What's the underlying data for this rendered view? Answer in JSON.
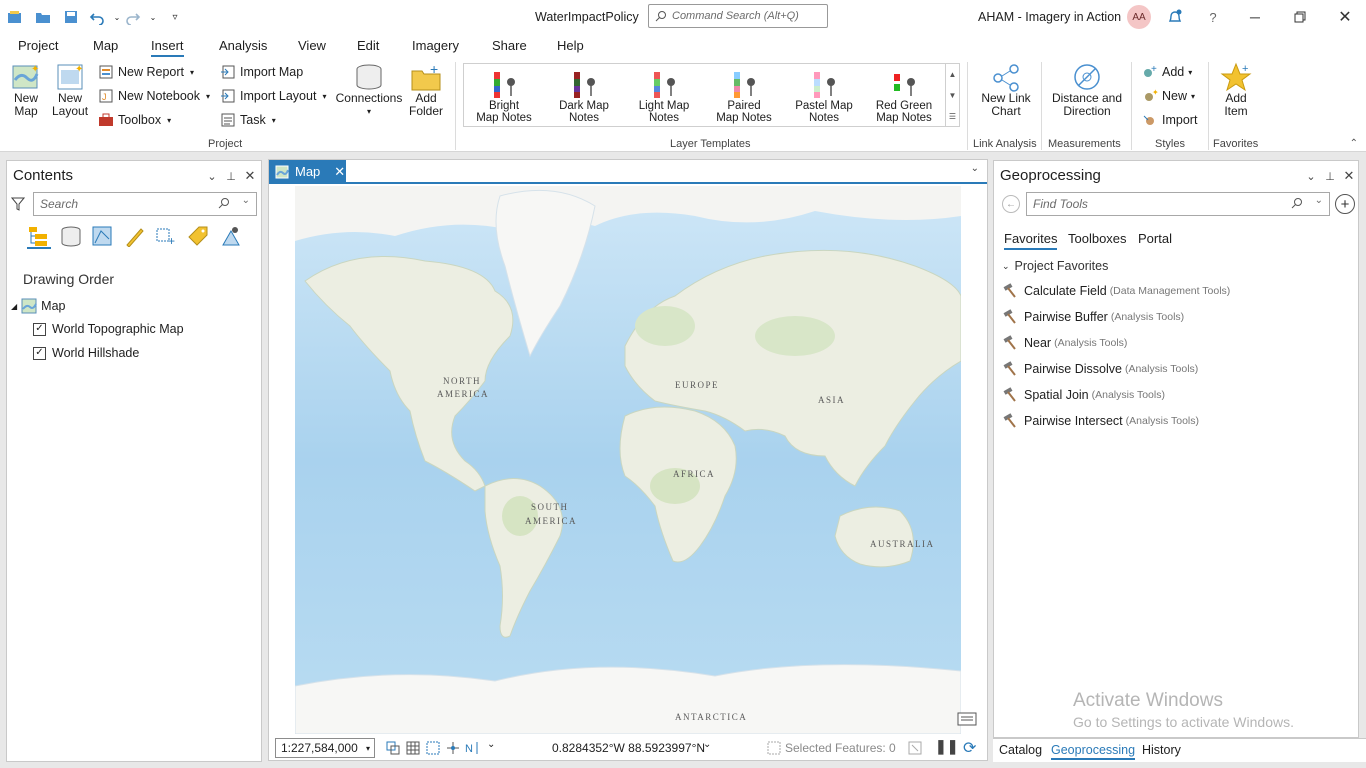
{
  "title_bar": {
    "title": "WaterImpactPolicy",
    "command_search_placeholder": "Command Search (Alt+Q)",
    "project_label": "AHAM - Imagery in Action",
    "user_initials": "AA"
  },
  "menu_tabs": [
    "Project",
    "Map",
    "Insert",
    "Analysis",
    "View",
    "Edit",
    "Imagery",
    "Share",
    "Help"
  ],
  "active_tab": "Insert",
  "ribbon": {
    "project_group": {
      "new_map": "New Map",
      "new_layout": "New Layout",
      "new_report": "New Report",
      "new_notebook": "New Notebook",
      "toolbox": "Toolbox",
      "import_map": "Import Map",
      "import_layout": "Import Layout",
      "task": "Task",
      "connections": "Connections",
      "add_folder_1": "Add",
      "add_folder_2": "Folder",
      "label": "Project"
    },
    "layer_templates": {
      "items": [
        {
          "l1": "Bright",
          "l2": "Map Notes"
        },
        {
          "l1": "Dark Map",
          "l2": "Notes"
        },
        {
          "l1": "Light Map",
          "l2": "Notes"
        },
        {
          "l1": "Paired",
          "l2": "Map Notes"
        },
        {
          "l1": "Pastel Map",
          "l2": "Notes"
        },
        {
          "l1": "Red Green",
          "l2": "Map Notes"
        }
      ],
      "label": "Layer Templates"
    },
    "link_analysis": {
      "l1": "New Link",
      "l2": "Chart",
      "label": "Link Analysis"
    },
    "measurements": {
      "l1": "Distance and",
      "l2": "Direction",
      "label": "Measurements"
    },
    "styles": {
      "add": "Add",
      "new": "New",
      "import": "Import",
      "label": "Styles"
    },
    "favorites": {
      "l1": "Add",
      "l2": "Item",
      "label": "Favorites"
    }
  },
  "contents": {
    "title": "Contents",
    "search_placeholder": "Search",
    "drawing_order": "Drawing Order",
    "map_name": "Map",
    "layers": [
      "World Topographic Map",
      "World Hillshade"
    ]
  },
  "map_view": {
    "tab_label": "Map",
    "continents": {
      "na1": "NORTH",
      "na2": "AMERICA",
      "sa1": "SOUTH",
      "sa2": "AMERICA",
      "europe": "EUROPE",
      "asia": "ASIA",
      "africa": "AFRICA",
      "australia": "AUSTRALIA",
      "antarctica": "ANTARCTICA"
    },
    "scale": "1:227,584,000",
    "coordinates": "0.8284352°W 88.5923997°N",
    "selected_features": "Selected Features: 0"
  },
  "geoprocessing": {
    "title": "Geoprocessing",
    "search_placeholder": "Find Tools",
    "tabs": [
      "Favorites",
      "Toolboxes",
      "Portal"
    ],
    "section": "Project Favorites",
    "tools": [
      {
        "name": "Calculate Field",
        "src": "(Data Management Tools)"
      },
      {
        "name": "Pairwise Buffer",
        "src": "(Analysis Tools)"
      },
      {
        "name": "Near",
        "src": "(Analysis Tools)"
      },
      {
        "name": "Pairwise Dissolve",
        "src": "(Analysis Tools)"
      },
      {
        "name": "Spatial Join",
        "src": "(Analysis Tools)"
      },
      {
        "name": "Pairwise Intersect",
        "src": "(Analysis Tools)"
      }
    ]
  },
  "bottom_tabs": [
    "Catalog",
    "Geoprocessing",
    "History"
  ],
  "watermark": {
    "line1": "Activate Windows",
    "line2": "Go to Settings to activate Windows."
  },
  "colors": {
    "accent": "#2a7ab8",
    "ocean": "#a9d2ee",
    "land": "#eeeee6"
  }
}
